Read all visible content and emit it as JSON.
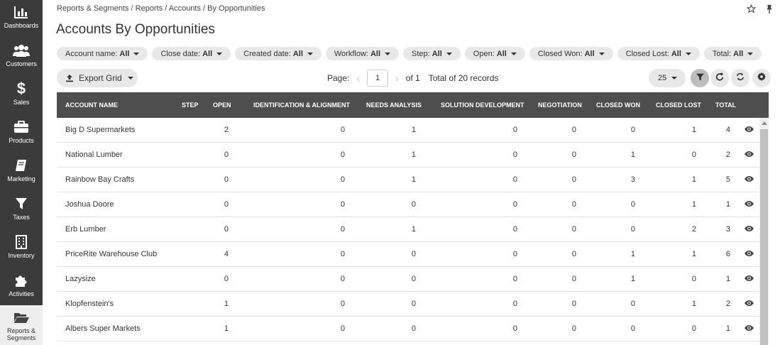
{
  "sidebar": {
    "items": [
      {
        "label": "Dashboards",
        "icon": "bar-chart-icon"
      },
      {
        "label": "Customers",
        "icon": "users-icon"
      },
      {
        "label": "Sales",
        "icon": "dollar-icon"
      },
      {
        "label": "Products",
        "icon": "briefcase-icon"
      },
      {
        "label": "Marketing",
        "icon": "book-icon"
      },
      {
        "label": "Taxes",
        "icon": "filter-icon"
      },
      {
        "label": "Inventory",
        "icon": "building-icon"
      },
      {
        "label": "Activities",
        "icon": "puzzle-icon"
      },
      {
        "label": "Reports &",
        "label2": "Segments",
        "icon": "folder-open-icon"
      }
    ]
  },
  "breadcrumb": "Reports & Segments / Reports / Accounts / By Opportunities",
  "title": "Accounts By Opportunities",
  "filters": [
    {
      "label": "Account name:",
      "value": "All"
    },
    {
      "label": "Close date:",
      "value": "All"
    },
    {
      "label": "Created date:",
      "value": "All"
    },
    {
      "label": "Workflow:",
      "value": "All"
    },
    {
      "label": "Step:",
      "value": "All"
    },
    {
      "label": "Open:",
      "value": "All"
    },
    {
      "label": "Closed Won:",
      "value": "All"
    },
    {
      "label": "Closed Lost:",
      "value": "All"
    },
    {
      "label": "Total:",
      "value": "All"
    }
  ],
  "toolbar": {
    "export_label": "Export Grid",
    "page_label": "Page:",
    "page_value": "1",
    "of_label": "of 1",
    "total_label": "Total of 20 records",
    "page_size": "25"
  },
  "table": {
    "columns": [
      "ACCOUNT NAME",
      "STEP",
      "OPEN",
      "IDENTIFICATION & ALIGNMENT",
      "NEEDS ANALYSIS",
      "SOLUTION DEVELOPMENT",
      "NEGOTIATION",
      "CLOSED WON",
      "CLOSED LOST",
      "TOTAL"
    ],
    "rows": [
      [
        "Big D Supermarkets",
        "",
        "2",
        "0",
        "1",
        "0",
        "0",
        "0",
        "1",
        "4"
      ],
      [
        "National Lumber",
        "",
        "0",
        "0",
        "1",
        "0",
        "0",
        "1",
        "0",
        "2"
      ],
      [
        "Rainbow Bay Crafts",
        "",
        "0",
        "0",
        "1",
        "0",
        "0",
        "3",
        "1",
        "5"
      ],
      [
        "Joshua Doore",
        "",
        "0",
        "0",
        "0",
        "0",
        "0",
        "0",
        "1",
        "1"
      ],
      [
        "Erb Lumber",
        "",
        "0",
        "0",
        "1",
        "0",
        "0",
        "0",
        "2",
        "3"
      ],
      [
        "PriceRite Warehouse Club",
        "",
        "4",
        "0",
        "0",
        "0",
        "0",
        "1",
        "1",
        "6"
      ],
      [
        "Lazysize",
        "",
        "0",
        "0",
        "0",
        "0",
        "0",
        "1",
        "0",
        "1"
      ],
      [
        "Klopfenstein's",
        "",
        "1",
        "0",
        "0",
        "0",
        "0",
        "0",
        "1",
        "2"
      ],
      [
        "Albers Super Markets",
        "",
        "1",
        "0",
        "0",
        "0",
        "0",
        "0",
        "0",
        "1"
      ]
    ]
  },
  "colors": {
    "sidebar_bg": "#3b3b3b",
    "header_bg": "#4e4e4e",
    "chip_bg": "#e8e8e8"
  }
}
